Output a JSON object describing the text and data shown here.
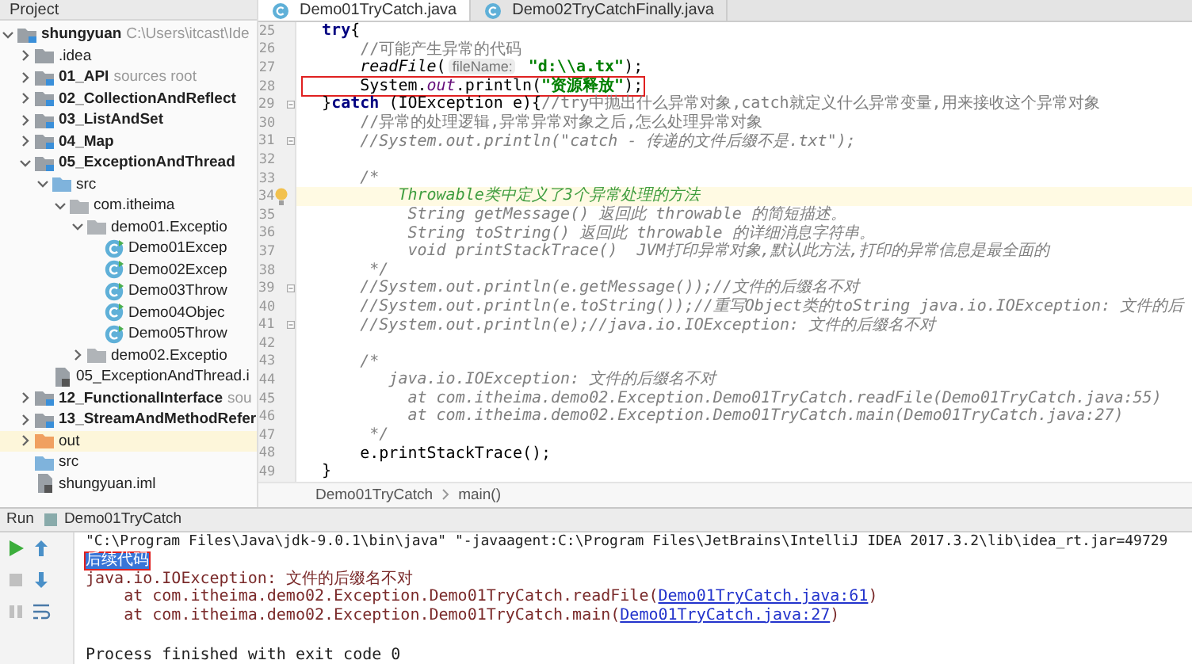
{
  "project_panel": {
    "title": "Project",
    "tree": [
      {
        "label": "shungyuan",
        "note": "C:\\Users\\itcast\\Ide",
        "kind": "module",
        "expanded": true,
        "children": [
          {
            "label": ".idea",
            "kind": "folder",
            "expanded": false
          },
          {
            "label": "01_API",
            "note": "sources root",
            "kind": "module",
            "expanded": false
          },
          {
            "label": "02_CollectionAndReflect",
            "kind": "module",
            "expanded": false
          },
          {
            "label": "03_ListAndSet",
            "kind": "module",
            "expanded": false
          },
          {
            "label": "04_Map",
            "kind": "module",
            "expanded": false
          },
          {
            "label": "05_ExceptionAndThread",
            "kind": "module",
            "expanded": true,
            "children": [
              {
                "label": "src",
                "kind": "src",
                "expanded": true,
                "children": [
                  {
                    "label": "com.itheima",
                    "kind": "package",
                    "expanded": true,
                    "children": [
                      {
                        "label": "demo01.Exceptio",
                        "kind": "package",
                        "expanded": true,
                        "children": [
                          {
                            "label": "Demo01Excep",
                            "kind": "class"
                          },
                          {
                            "label": "Demo02Excep",
                            "kind": "class"
                          },
                          {
                            "label": "Demo03Throw",
                            "kind": "class"
                          },
                          {
                            "label": "Demo04Objec",
                            "kind": "class"
                          },
                          {
                            "label": "Demo05Throw",
                            "kind": "class"
                          }
                        ]
                      },
                      {
                        "label": "demo02.Exceptio",
                        "kind": "package",
                        "expanded": false
                      }
                    ]
                  }
                ]
              },
              {
                "label": "05_ExceptionAndThread.i",
                "kind": "file"
              }
            ]
          },
          {
            "label": "12_FunctionalInterface",
            "note": "sou",
            "kind": "module",
            "expanded": false
          },
          {
            "label": "13_StreamAndMethodRefer",
            "kind": "module",
            "expanded": false
          },
          {
            "label": "out",
            "kind": "out",
            "expanded": false
          },
          {
            "label": "src",
            "kind": "src"
          },
          {
            "label": "shungyuan.iml",
            "kind": "file"
          }
        ]
      }
    ]
  },
  "editor": {
    "tabs": [
      {
        "label": "Demo01TryCatch.java",
        "selected": true
      },
      {
        "label": "Demo02TryCatchFinally.java",
        "selected": false
      }
    ],
    "lines": [
      {
        "number": "25",
        "current": false,
        "boxed": false,
        "fold": false,
        "tokens": [
          {
            "text": "  try",
            "kind": "kw"
          },
          {
            "text": "{",
            "kind": "plain"
          }
        ]
      },
      {
        "number": "26",
        "current": false,
        "boxed": false,
        "fold": false,
        "tokens": [
          {
            "text": "      //可能产生异常的代码",
            "kind": "comment"
          }
        ]
      },
      {
        "number": "27",
        "current": false,
        "boxed": false,
        "fold": false,
        "tokens": [
          {
            "text": "      readFile",
            "kind": "method"
          },
          {
            "text": "(",
            "kind": "plain"
          },
          {
            "text": "fileName:",
            "kind": "hint"
          },
          {
            "text": " \"d:\\\\a.tx\"",
            "kind": "str"
          },
          {
            "text": ");",
            "kind": "plain"
          }
        ]
      },
      {
        "number": "28",
        "current": false,
        "boxed": true,
        "fold": false,
        "tokens": [
          {
            "text": "      System.",
            "kind": "plain"
          },
          {
            "text": "out",
            "kind": "field"
          },
          {
            "text": ".println(",
            "kind": "plain"
          },
          {
            "text": "\"资源释放\"",
            "kind": "str"
          },
          {
            "text": ");",
            "kind": "plain"
          }
        ]
      },
      {
        "number": "29",
        "current": false,
        "boxed": false,
        "fold": true,
        "tokens": [
          {
            "text": "  }",
            "kind": "plain"
          },
          {
            "text": "catch",
            "kind": "kw"
          },
          {
            "text": " (IOException e){",
            "kind": "plain"
          },
          {
            "text": "//try中抛出什么异常对象,catch就定义什么异常变量,用来接收这个异常对象",
            "kind": "comment"
          }
        ]
      },
      {
        "number": "30",
        "current": false,
        "boxed": false,
        "fold": false,
        "tokens": [
          {
            "text": "      //异常的处理逻辑,异常异常对象之后,怎么处理异常对象",
            "kind": "comment"
          }
        ]
      },
      {
        "number": "31",
        "current": false,
        "boxed": false,
        "fold": true,
        "tokens": [
          {
            "text": "      //System.out.println(\"catch - 传递的文件后缀不是.txt\");",
            "kind": "block"
          }
        ]
      },
      {
        "number": "32",
        "current": false,
        "boxed": false,
        "fold": false
      },
      {
        "number": "33",
        "current": false,
        "boxed": false,
        "fold": false,
        "tokens": [
          {
            "text": "      /*",
            "kind": "block"
          }
        ]
      },
      {
        "number": "34",
        "current": true,
        "boxed": false,
        "fold": false,
        "tokens": [
          {
            "text": "          Throwable类中定义了3个异常处理的方法",
            "kind": "doc"
          }
        ]
      },
      {
        "number": "35",
        "current": false,
        "boxed": false,
        "fold": false,
        "tokens": [
          {
            "text": "           String getMessage() 返回此 throwable 的简短描述。",
            "kind": "block"
          }
        ]
      },
      {
        "number": "36",
        "current": false,
        "boxed": false,
        "fold": false,
        "tokens": [
          {
            "text": "           String toString() 返回此 throwable 的详细消息字符串。",
            "kind": "block"
          }
        ]
      },
      {
        "number": "37",
        "current": false,
        "boxed": false,
        "fold": false,
        "tokens": [
          {
            "text": "           void printStackTrace()  JVM打印异常对象,默认此方法,打印的异常信息是最全面的",
            "kind": "block"
          }
        ]
      },
      {
        "number": "38",
        "current": false,
        "boxed": false,
        "fold": false,
        "tokens": [
          {
            "text": "       */",
            "kind": "block"
          }
        ]
      },
      {
        "number": "39",
        "current": false,
        "boxed": false,
        "fold": true,
        "tokens": [
          {
            "text": "      //System.out.println(e.getMessage());//文件的后缀名不对",
            "kind": "block"
          }
        ]
      },
      {
        "number": "40",
        "current": false,
        "boxed": false,
        "fold": false,
        "tokens": [
          {
            "text": "      //System.out.println(e.toString());//重写Object类的toString java.io.IOException: 文件的后",
            "kind": "block"
          }
        ]
      },
      {
        "number": "41",
        "current": false,
        "boxed": false,
        "fold": true,
        "tokens": [
          {
            "text": "      //System.out.println(e);//java.io.IOException: 文件的后缀名不对",
            "kind": "block"
          }
        ]
      },
      {
        "number": "42",
        "current": false,
        "boxed": false,
        "fold": false
      },
      {
        "number": "43",
        "current": false,
        "boxed": false,
        "fold": false,
        "tokens": [
          {
            "text": "      /*",
            "kind": "block"
          }
        ]
      },
      {
        "number": "44",
        "current": false,
        "boxed": false,
        "fold": false,
        "tokens": [
          {
            "text": "         java.io.IOException: 文件的后缀名不对",
            "kind": "block"
          }
        ]
      },
      {
        "number": "45",
        "current": false,
        "boxed": false,
        "fold": false,
        "tokens": [
          {
            "text": "           at com.itheima.demo02.Exception.Demo01TryCatch.readFile(Demo01TryCatch.java:55)",
            "kind": "block"
          }
        ]
      },
      {
        "number": "46",
        "current": false,
        "boxed": false,
        "fold": false,
        "tokens": [
          {
            "text": "           at com.itheima.demo02.Exception.Demo01TryCatch.main(Demo01TryCatch.java:27)",
            "kind": "block"
          }
        ]
      },
      {
        "number": "47",
        "current": false,
        "boxed": false,
        "fold": false,
        "tokens": [
          {
            "text": "       */",
            "kind": "block"
          }
        ]
      },
      {
        "number": "48",
        "current": false,
        "boxed": false,
        "fold": false,
        "tokens": [
          {
            "text": "      e.printStackTrace();",
            "kind": "plain"
          }
        ]
      },
      {
        "number": "49",
        "current": false,
        "boxed": false,
        "fold": false,
        "tokens": [
          {
            "text": "  }",
            "kind": "plain"
          }
        ]
      }
    ],
    "breadcrumbs": [
      "Demo01TryCatch",
      "main()"
    ]
  },
  "run_panel": {
    "title": "Run",
    "tab": "Demo01TryCatch",
    "lines": [
      {
        "kind": "command",
        "text": "\"C:\\Program Files\\Java\\jdk-9.0.1\\bin\\java\" \"-javaagent:C:\\Program Files\\JetBrains\\IntelliJ IDEA 2017.3.2\\lib\\idea_rt.jar=49729",
        "selected": false,
        "boxed": false
      },
      {
        "kind": "output",
        "text": "后续代码",
        "selected": true,
        "boxed": true
      },
      {
        "kind": "error",
        "text": "java.io.IOException: 文件的后缀名不对",
        "selected": false,
        "boxed": false
      },
      {
        "kind": "trace",
        "text": "    at com.itheima.demo02.Exception.Demo01TryCatch.readFile(",
        "link": "Demo01TryCatch.java:61",
        "after": ")",
        "selected": false,
        "boxed": false
      },
      {
        "kind": "trace",
        "text": "    at com.itheima.demo02.Exception.Demo01TryCatch.main(",
        "link": "Demo01TryCatch.java:27",
        "after": ")",
        "selected": false,
        "boxed": false
      },
      {
        "kind": "blank",
        "selected": false,
        "boxed": false
      },
      {
        "kind": "output",
        "text": "Process finished with exit code 0",
        "selected": false,
        "boxed": false
      }
    ]
  }
}
